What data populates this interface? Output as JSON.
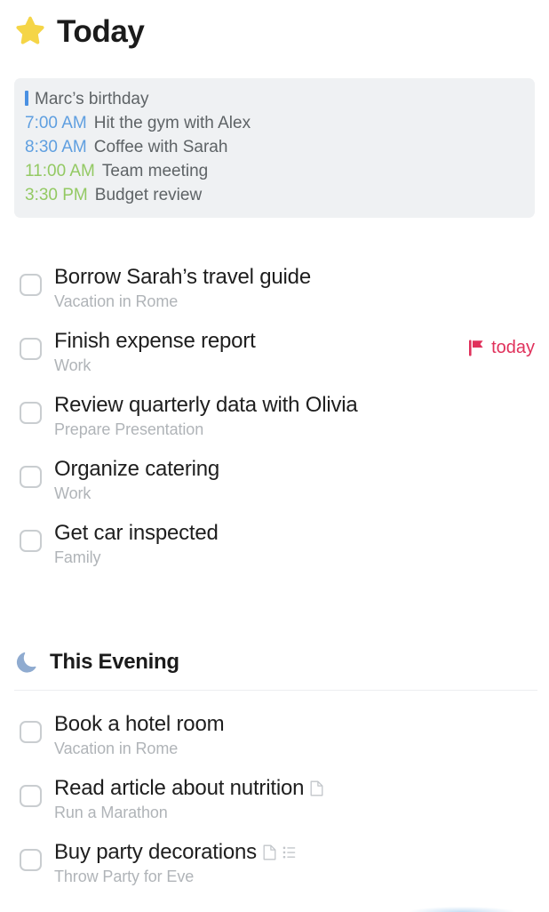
{
  "header": {
    "icon": "star-icon",
    "title": "Today",
    "star_color": "#f5d547"
  },
  "calendar": {
    "background": "#eff1f3",
    "allday_bar_color": "#4a90e2",
    "time_color_blue": "#5f9fe0",
    "time_color_green": "#93c963",
    "events": [
      {
        "allday": true,
        "time": "",
        "time_style": "",
        "text": "Marc’s birthday"
      },
      {
        "allday": false,
        "time": "7:00 AM",
        "time_style": "blue",
        "text": "Hit the gym with Alex"
      },
      {
        "allday": false,
        "time": "8:30 AM",
        "time_style": "blue",
        "text": "Coffee with Sarah"
      },
      {
        "allday": false,
        "time": "11:00 AM",
        "time_style": "green",
        "text": "Team meeting"
      },
      {
        "allday": false,
        "time": "3:30 PM",
        "time_style": "green",
        "text": "Budget review"
      }
    ]
  },
  "today_tasks": [
    {
      "title": "Borrow Sarah’s travel guide",
      "subtitle": "Vacation in Rome",
      "checked": false,
      "due_label": "",
      "due_icon": "",
      "icons": []
    },
    {
      "title": "Finish expense report",
      "subtitle": "Work",
      "checked": false,
      "due_label": "today",
      "due_icon": "flag-icon",
      "icons": []
    },
    {
      "title": "Review quarterly data with Olivia",
      "subtitle": "Prepare Presentation",
      "checked": false,
      "due_label": "",
      "due_icon": "",
      "icons": []
    },
    {
      "title": "Organize catering",
      "subtitle": "Work",
      "checked": false,
      "due_label": "",
      "due_icon": "",
      "icons": []
    },
    {
      "title": "Get car inspected",
      "subtitle": "Family",
      "checked": false,
      "due_label": "",
      "due_icon": "",
      "icons": []
    }
  ],
  "evening_section": {
    "icon": "moon-icon",
    "title": "This Evening",
    "moon_color": "#8fabd0"
  },
  "evening_tasks": [
    {
      "title": "Book a hotel room",
      "subtitle": "Vacation in Rome",
      "checked": false,
      "due_label": "",
      "due_icon": "",
      "icons": [
        "note-icon"
      ]
    },
    {
      "title": "Read article about nutrition",
      "subtitle": "Run a Marathon",
      "checked": false,
      "due_label": "",
      "due_icon": "",
      "icons": [
        "note-icon"
      ]
    },
    {
      "title": "Buy party decorations",
      "subtitle": "Throw Party for Eve",
      "checked": false,
      "due_label": "",
      "due_icon": "",
      "icons": [
        "note-icon",
        "checklist-icon"
      ]
    }
  ],
  "colors": {
    "accent_red": "#e0315b",
    "checkbox_border": "#c9cdd0",
    "subtitle_gray": "#b0b4b8",
    "title_dark": "#1e1e1e",
    "divider": "#eceef0"
  }
}
